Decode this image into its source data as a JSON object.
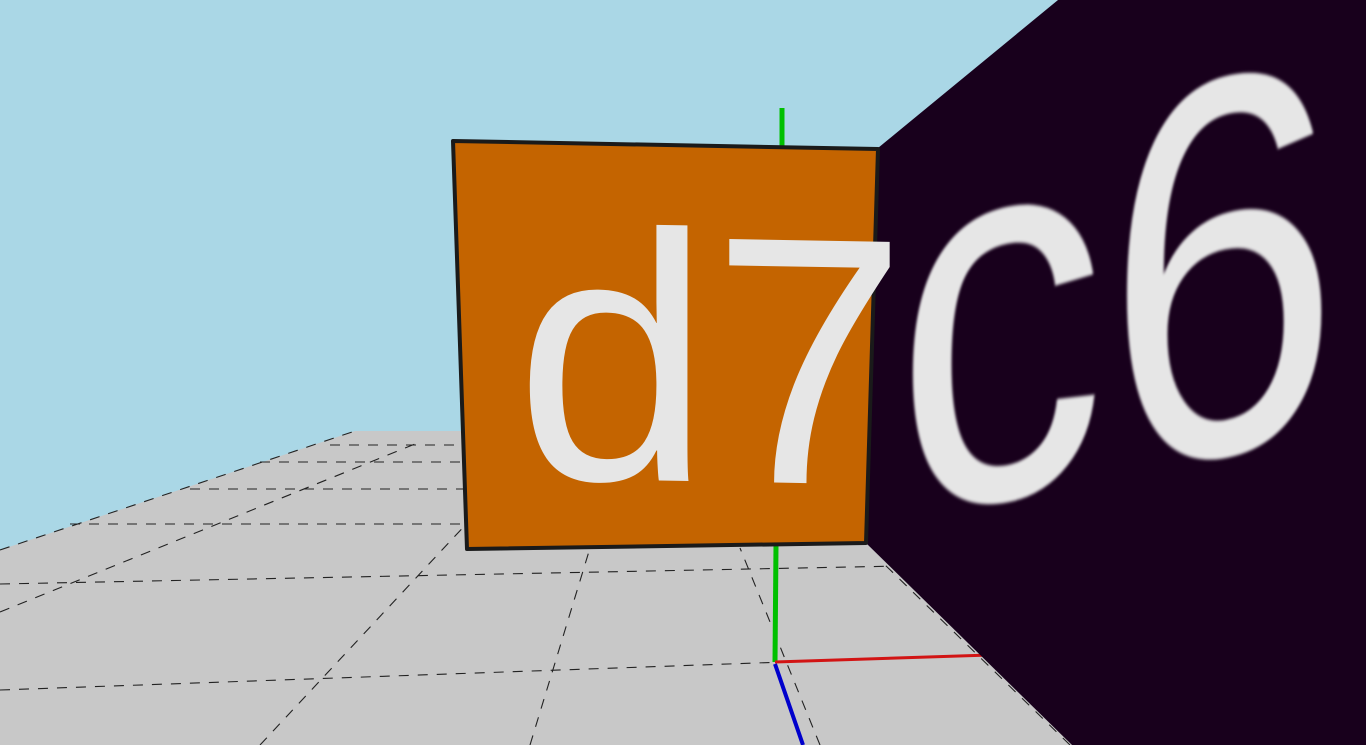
{
  "scene": {
    "type": "3d-viewport",
    "sky_color": "#aad7e6",
    "floor_color": "#c8c8c8",
    "grid_color": "#222222",
    "grid_style": "dashed",
    "axes": {
      "x_color": "#d21414",
      "y_color": "#00c000",
      "z_color": "#0000cc"
    },
    "cubes": [
      {
        "label": "d7",
        "face_color": "#c46400",
        "text_color": "#e6e6e6",
        "outline_color": "#1a1a1a"
      },
      {
        "label": "c6",
        "face_color": "#18001c",
        "text_color": "#e6e6e6"
      }
    ]
  }
}
